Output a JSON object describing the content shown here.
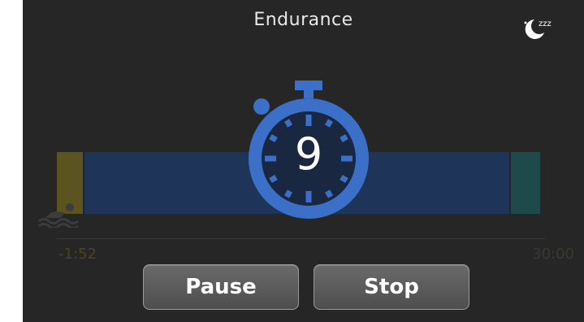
{
  "header": {
    "title": "Endurance",
    "sleep_icon": "sleep-moon-zzz-icon"
  },
  "timeline": {
    "start_label": "-1:52",
    "end_label": "30:00",
    "activity_icon": "swimmer-icon",
    "colors": {
      "warmup": "#5b5420",
      "main": "#1f3459",
      "cooldown": "#1f4a4b"
    }
  },
  "countdown": {
    "value": "9",
    "icon": "stopwatch-icon",
    "color": "#3b6fc8"
  },
  "controls": {
    "pause_label": "Pause",
    "stop_label": "Stop"
  }
}
